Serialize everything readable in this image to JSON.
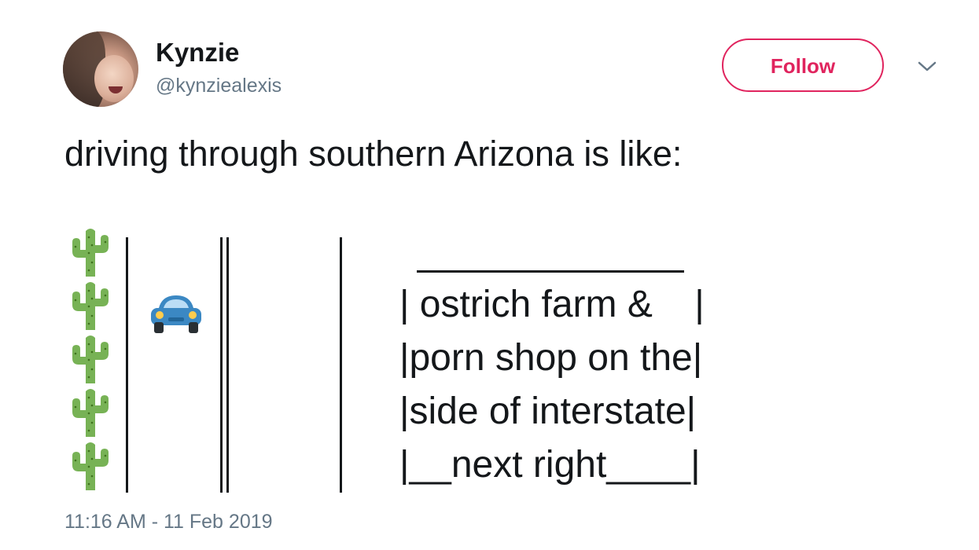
{
  "user": {
    "name": "Kynzie",
    "handle": "@kynziealexis"
  },
  "follow_label": "Follow",
  "tweet": {
    "text": "driving through southern Arizona is like:",
    "sign_lines": [
      "| ostrich farm &    |",
      "|porn shop on the|",
      "|side of interstate|",
      "|__next right____|"
    ],
    "timestamp": "11:16 AM - 11 Feb 2019"
  },
  "icons": {
    "cactus": "cactus-emoji",
    "car": "car-emoji",
    "menu": "chevron-down-icon"
  },
  "colors": {
    "accent": "#e0245e",
    "text": "#14171a",
    "muted": "#657786"
  }
}
